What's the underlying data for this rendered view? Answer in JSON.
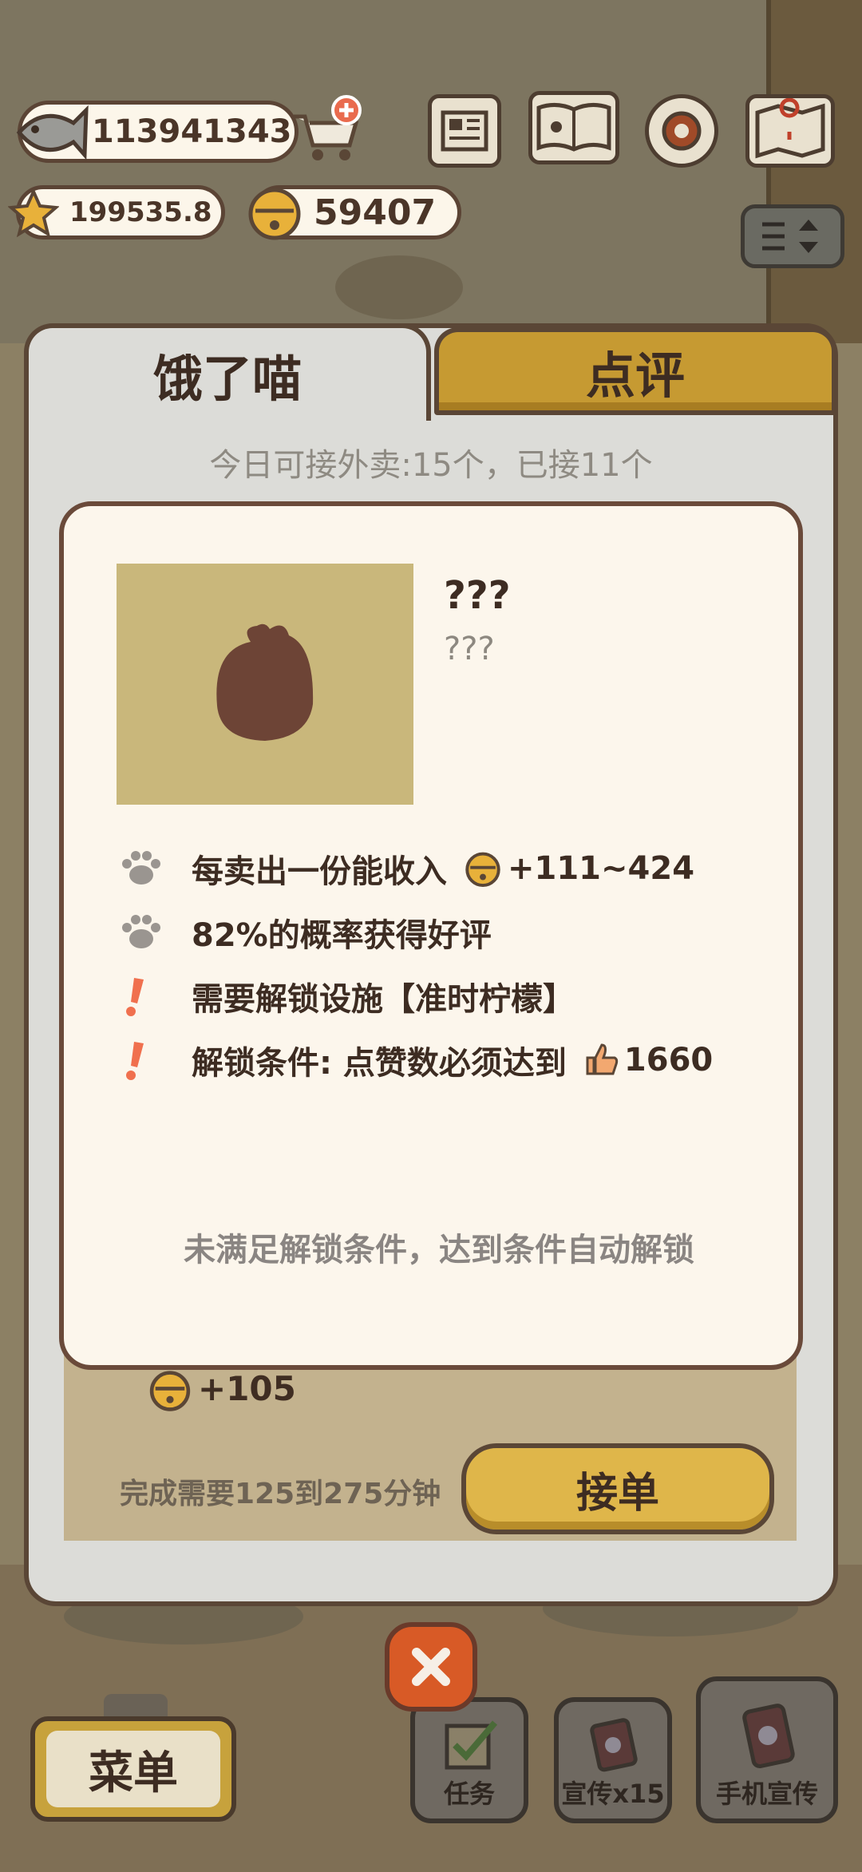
{
  "hud": {
    "fish": "113941343",
    "stars": "199535.8",
    "bells": "59407"
  },
  "tabs": {
    "active": "饿了喵",
    "inactive": "点评"
  },
  "quota_text": "今日可接外卖:15个，已接11个",
  "card": {
    "name": "???",
    "desc": "???",
    "rows": [
      {
        "icon": "paw-icon",
        "text": "每卖出一份能收入",
        "suffix_icon": "bell-icon",
        "suffix": "+111~424"
      },
      {
        "icon": "paw-icon",
        "text": "82%的概率获得好评"
      },
      {
        "icon": "exclamation-icon",
        "text": "需要解锁设施【准时柠檬】"
      },
      {
        "icon": "exclamation-icon",
        "text": "解锁条件: 点赞数必须达到",
        "suffix_icon": "thumbs-up-icon",
        "suffix": "1660"
      }
    ],
    "footer": "未满足解锁条件，达到条件自动解锁"
  },
  "order": {
    "reward": "+105",
    "time": "完成需要125到275分钟",
    "accept": "接单"
  },
  "bottom_bar": {
    "menu": "菜单",
    "tasks": "任务",
    "promo": "宣传x15",
    "phone_promo": "手机宣传"
  },
  "colors": {
    "accent_gold": "#c69a32",
    "panel_cream": "#fcf6ec",
    "outline_brown": "#5a4636",
    "close_orange": "#d85a26"
  }
}
